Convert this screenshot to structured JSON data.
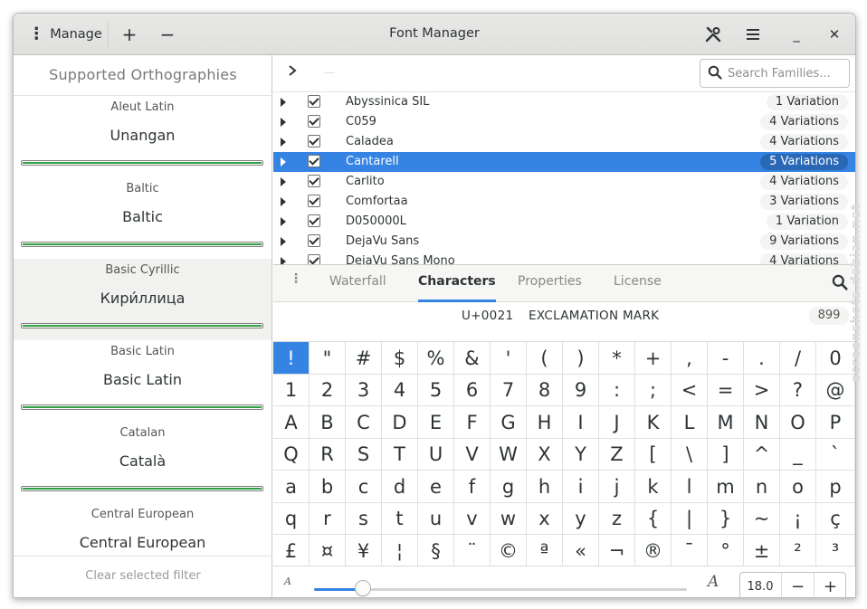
{
  "header": {
    "manage_label": "Manage",
    "plus_label": "+",
    "minus_label": "−",
    "title": "Font Manager",
    "menu_glyph": "≡",
    "minimize_glyph": "_",
    "close_glyph": "✕"
  },
  "sidebar": {
    "title": "Supported Orthographies",
    "items": [
      {
        "name": "Aleut Latin",
        "native": "Unangan",
        "coverage": 100
      },
      {
        "name": "Baltic",
        "native": "Baltic",
        "coverage": 100
      },
      {
        "name": "Basic Cyrillic",
        "native": "Кири́ллица",
        "coverage": 100,
        "selected": true
      },
      {
        "name": "Basic Latin",
        "native": "Basic Latin",
        "coverage": 100
      },
      {
        "name": "Catalan",
        "native": "Català",
        "coverage": 100
      },
      {
        "name": "Central European",
        "native": "Central European",
        "coverage": 100
      }
    ],
    "footer": "Clear selected filter"
  },
  "search": {
    "placeholder": "Search Families..."
  },
  "families": [
    {
      "name": "Abyssinica SIL",
      "variations": "1 Variation"
    },
    {
      "name": "C059",
      "variations": "4 Variations"
    },
    {
      "name": "Caladea",
      "variations": "4 Variations"
    },
    {
      "name": "Cantarell",
      "variations": "5 Variations",
      "selected": true
    },
    {
      "name": "Carlito",
      "variations": "4 Variations"
    },
    {
      "name": "Comfortaa",
      "variations": "3 Variations"
    },
    {
      "name": "D050000L",
      "variations": "1 Variation"
    },
    {
      "name": "DejaVu Sans",
      "variations": "9 Variations"
    },
    {
      "name": "DejaVu Sans Mono",
      "variations": "4 Variations"
    }
  ],
  "tabs": {
    "waterfall": "Waterfall",
    "characters": "Characters",
    "properties": "Properties",
    "license": "License"
  },
  "char_info": {
    "code": "U+0021",
    "name": "EXCLAMATION MARK",
    "count": "899"
  },
  "characters": [
    "!",
    "\"",
    "#",
    "$",
    "%",
    "&",
    "'",
    "(",
    ")",
    "*",
    "+",
    ",",
    "-",
    ".",
    "/",
    "0",
    "1",
    "2",
    "3",
    "4",
    "5",
    "6",
    "7",
    "8",
    "9",
    ":",
    ";",
    "<",
    "=",
    ">",
    "?",
    "@",
    "A",
    "B",
    "C",
    "D",
    "E",
    "F",
    "G",
    "H",
    "I",
    "J",
    "K",
    "L",
    "M",
    "N",
    "O",
    "P",
    "Q",
    "R",
    "S",
    "T",
    "U",
    "V",
    "W",
    "X",
    "Y",
    "Z",
    "[",
    "\\",
    "]",
    "^",
    "_",
    "`",
    "a",
    "b",
    "c",
    "d",
    "e",
    "f",
    "g",
    "h",
    "i",
    "j",
    "k",
    "l",
    "m",
    "n",
    "o",
    "p",
    "q",
    "r",
    "s",
    "t",
    "u",
    "v",
    "w",
    "x",
    "y",
    "z",
    "{",
    "|",
    "}",
    "~",
    "¡",
    "ç",
    "£",
    "¤",
    "¥",
    "¦",
    "§",
    "¨",
    "©",
    "ª",
    "«",
    "¬",
    "®",
    "¯",
    "°",
    "±",
    "²",
    "³"
  ],
  "selected_char_index": 0,
  "size_control": {
    "small_glyph": "A",
    "large_glyph": "A",
    "value": "18.0",
    "slider_fraction": 0.13,
    "minus": "−",
    "plus": "+"
  },
  "watermark": "screenshots.debian.net",
  "colors": {
    "accent": "#3584e4",
    "coverage": "#2ea043"
  }
}
